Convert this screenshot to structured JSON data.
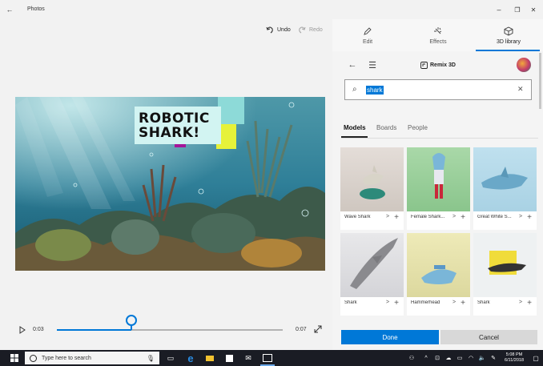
{
  "window": {
    "title": "Photos",
    "back_glyph": "←",
    "minimize_glyph": "–",
    "restore_glyph": "❐",
    "close_glyph": "✕"
  },
  "toolbar": {
    "undo_label": "Undo",
    "redo_label": "Redo"
  },
  "video": {
    "overlay_line1": "ROBOTIC",
    "overlay_line2": "SHARK!"
  },
  "playback": {
    "current_time": "0:03",
    "end_time": "0:07",
    "progress": 0.33
  },
  "panel": {
    "tabs": [
      {
        "label": "Edit",
        "icon": "pencil-icon"
      },
      {
        "label": "Effects",
        "icon": "sparkle-icon"
      },
      {
        "label": "3D library",
        "icon": "cube-icon"
      }
    ],
    "active_tab": "3D library",
    "brand": "Remix 3D",
    "search": {
      "value": "shark"
    },
    "filter_tabs": [
      "Models",
      "Boards",
      "People"
    ],
    "active_filter": "Models",
    "models": [
      {
        "label": "Wave Shark",
        "chevron": ">",
        "add": "+"
      },
      {
        "label": "Female Shark...",
        "chevron": ">",
        "add": "+"
      },
      {
        "label": "Great White S...",
        "chevron": ">",
        "add": "+"
      },
      {
        "label": "Shark",
        "chevron": ">",
        "add": "+"
      },
      {
        "label": "Hammerhead",
        "chevron": ">",
        "add": "+"
      },
      {
        "label": "Shark",
        "chevron": ">",
        "add": "+"
      }
    ],
    "done_label": "Done",
    "cancel_label": "Cancel"
  },
  "taskbar": {
    "search_placeholder": "Type here to search",
    "time": "5:08 PM",
    "date": "6/11/2018"
  },
  "colors": {
    "accent": "#0078d7",
    "done": "#0078d7",
    "cancel": "#d8d8d8",
    "taskbar": "#1a1c24"
  }
}
